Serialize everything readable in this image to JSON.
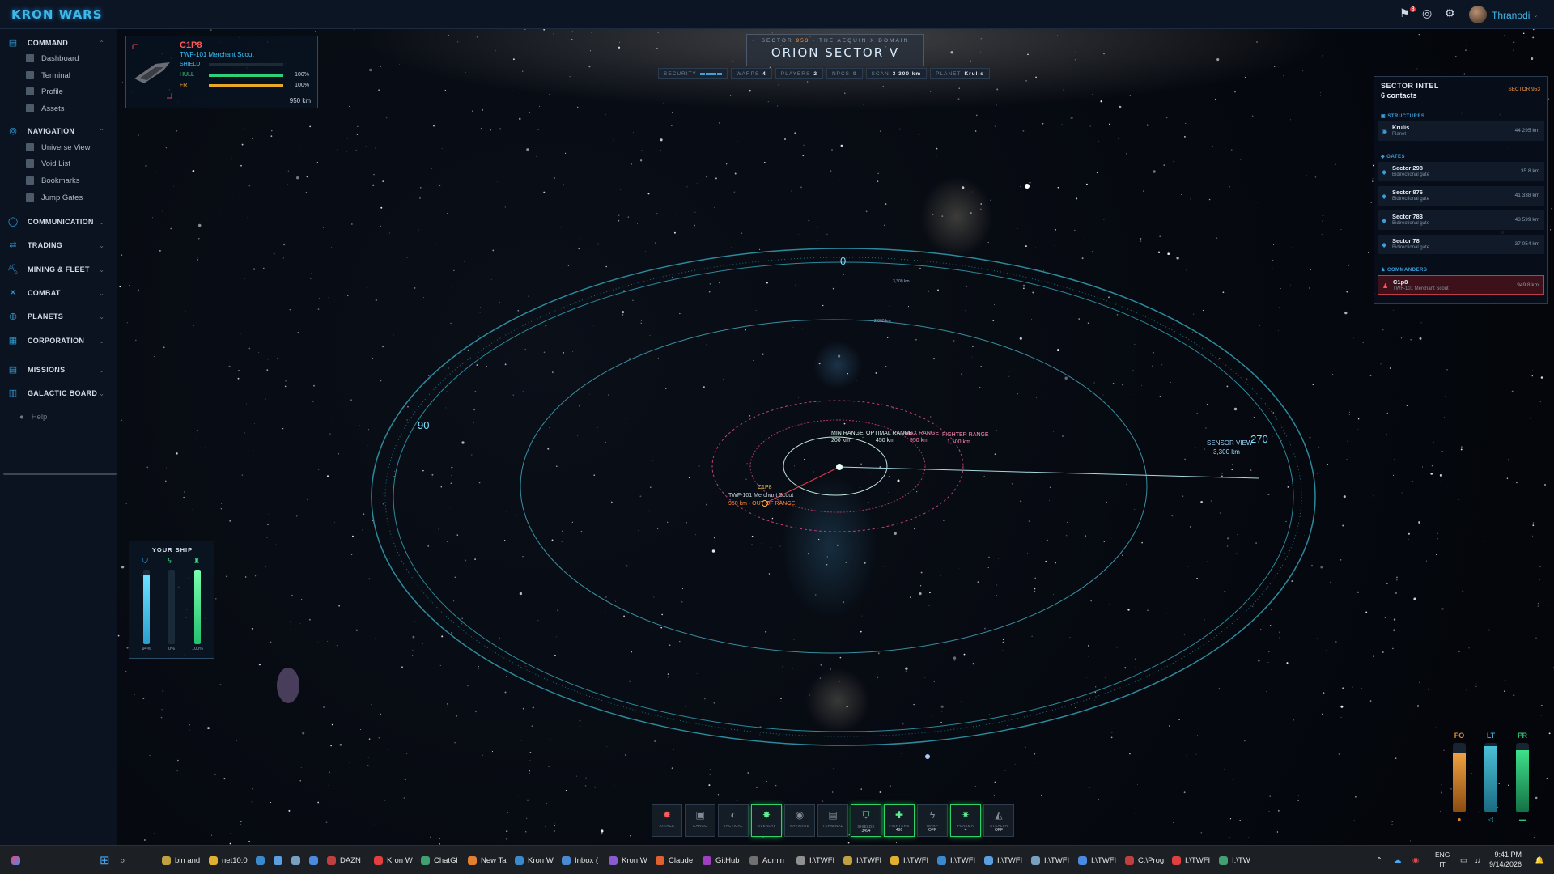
{
  "app": {
    "title": "KRON WARS"
  },
  "topbar": {
    "notif_count": "3",
    "user": "Thranodi"
  },
  "sidebar": {
    "command": {
      "label": "COMMAND",
      "items": [
        "Dashboard",
        "Terminal",
        "Profile",
        "Assets"
      ]
    },
    "navigation": {
      "label": "NAVIGATION",
      "items": [
        "Universe View",
        "Void List",
        "Bookmarks",
        "Jump Gates"
      ]
    },
    "communication": "COMMUNICATION",
    "trading": "TRADING",
    "mining": "MINING & FLEET",
    "combat": "COMBAT",
    "planets": "PLANETS",
    "corporation": "CORPORATION",
    "missions": "MISSIONS",
    "galactic": "GALACTIC BOARD",
    "help": "Help"
  },
  "ship_card": {
    "name": "C1P8",
    "model": "TWF-101 Merchant Scout",
    "shield_label": "SHIELD",
    "shield_val": "",
    "hull_label": "HULL",
    "hull_val": "100%",
    "fr_label": "FR",
    "fr_val": "100%",
    "distance": "950 km",
    "shield_pct": 0,
    "hull_pct": 1,
    "fr_pct": 1
  },
  "sector": {
    "subtitle_a": "SECTOR",
    "subtitle_num": "953",
    "subtitle_b": "THE AEQUINIX DOMAIN",
    "name": "ORION SECTOR V",
    "stats": {
      "security_label": "SECURITY",
      "warps_label": "WARPS",
      "warps": "4",
      "players_label": "PLAYERS",
      "players": "2",
      "npcs_label": "NPCS",
      "npcs": "0",
      "scan_label": "SCAN",
      "scan": "3 300 km",
      "planet_label": "PLANET",
      "planet": "Krulis"
    }
  },
  "intel": {
    "title": "SECTOR INTEL",
    "count": "6 contacts",
    "tag": "SECTOR 953",
    "structures_label": "STRUCTURES",
    "gates_label": "GATES",
    "commanders_label": "COMMANDERS",
    "structures": [
      {
        "name": "Krulis",
        "sub": "Planet",
        "dist": "44 295 km"
      }
    ],
    "gates": [
      {
        "name": "Sector 298",
        "sub": "Bidirectional gate",
        "dist": "35.8 km"
      },
      {
        "name": "Sector 876",
        "sub": "Bidirectional gate",
        "dist": "41 338 km"
      },
      {
        "name": "Sector 783",
        "sub": "Bidirectional gate",
        "dist": "43 599 km"
      },
      {
        "name": "Sector 78",
        "sub": "Bidirectional gate",
        "dist": "37 054 km"
      }
    ],
    "commanders": [
      {
        "name": "C1p8",
        "sub": "TWF-101 Merchant Scout",
        "dist": "949.8 km"
      }
    ]
  },
  "radar": {
    "deg_0": "0",
    "deg_90": "90",
    "deg_270": "270",
    "sensor_label": "SENSOR VIEW",
    "sensor_range": "3,300 km",
    "ring_outer": "3,300 km",
    "ring_mid": "2,000 km",
    "min_range": "MIN RANGE",
    "min_val": "200 km",
    "optimal": "OPTIMAL RANGE",
    "optimal_val": "450 km",
    "max": "MAX RANGE",
    "max_val": "950 km",
    "fighter": "FIGHTER RANGE",
    "fighter_val": "1,100 km",
    "target_name": "C1P8",
    "target_model": "TWF-101 Merchant Scout",
    "target_status": "950 km · OUT OF RANGE"
  },
  "your_ship": {
    "title": "YOUR SHIP",
    "shield_val": "94%",
    "energy_val": "0%",
    "hull_val": "100%",
    "shield_pct": 0.94,
    "energy_pct": 0,
    "hull_pct": 1
  },
  "gauges": [
    {
      "label": "FO",
      "pct": 0.85,
      "color": "#e28a2a"
    },
    {
      "label": "LT",
      "pct": 0.95,
      "color": "#3aa6c0"
    },
    {
      "label": "FR",
      "pct": 0.9,
      "color": "#2cc27a"
    }
  ],
  "actions": [
    {
      "icon": "✹",
      "label": "ATTACK",
      "val": "",
      "state": "red"
    },
    {
      "icon": "▣",
      "label": "CARGO",
      "val": "",
      "state": ""
    },
    {
      "icon": "◐",
      "label": "TACTICAL",
      "val": "",
      "state": ""
    },
    {
      "icon": "✸",
      "label": "OVERLAY",
      "val": "",
      "state": "on"
    },
    {
      "icon": "◉",
      "label": "NAVIGATE",
      "val": "",
      "state": ""
    },
    {
      "icon": "▤",
      "label": "TERMINAL",
      "val": "",
      "state": ""
    },
    {
      "icon": "⛉",
      "label": "SHIELDS",
      "val": "3494",
      "state": "on"
    },
    {
      "icon": "✚",
      "label": "FIGHTERS",
      "val": "496",
      "state": "on"
    },
    {
      "icon": "ϟ",
      "label": "WARP",
      "val": "OFF",
      "state": ""
    },
    {
      "icon": "✷",
      "label": "PLASMA",
      "val": "4",
      "state": "on"
    },
    {
      "icon": "◭",
      "label": "STEALTH",
      "val": "OFF",
      "state": ""
    }
  ],
  "taskbar": {
    "items": [
      "bin and",
      "net10.0",
      "",
      "",
      "",
      "",
      "DAZN",
      "Kron W",
      "ChatGl",
      "New Ta",
      "Kron W",
      "Inbox (",
      "Kron W",
      "Claude",
      "GitHub",
      "Admin",
      "I:\\TWFI",
      "I:\\TWFI",
      "I:\\TWFI",
      "I:\\TWFI",
      "I:\\TWFI",
      "I:\\TWFI",
      "I:\\TWFI",
      "C:\\Prog",
      "I:\\TWFI",
      "I:\\TW"
    ],
    "lang": "ENG",
    "region": "IT",
    "time": "9:41 PM",
    "date": "9/14/2026"
  }
}
